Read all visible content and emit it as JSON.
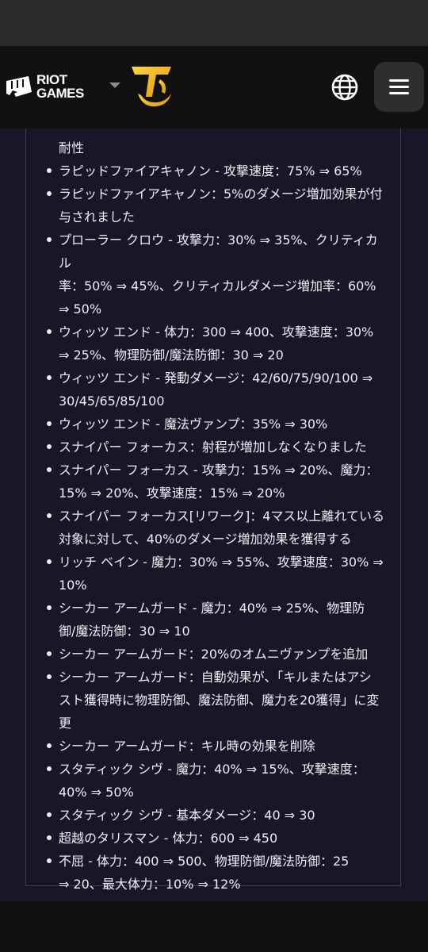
{
  "header": {
    "brand_line1": "RIOT",
    "brand_line2": "GAMES",
    "game_logo": "tft-logo",
    "language_icon": "globe-icon",
    "menu_icon": "hamburger-menu-icon"
  },
  "notes": {
    "cutoff_top": "…",
    "items": [
      {
        "lines": [
          "耐性"
        ],
        "continuation": true
      },
      {
        "lines": [
          "ラピッドファイアキャノン - 攻撃速度：75% ⇒ 65%"
        ]
      },
      {
        "lines": [
          "ラピッドファイアキャノン：5%のダメージ増加効果が付",
          "与されました"
        ]
      },
      {
        "lines": [
          "プローラー クロウ - 攻撃力：30% ⇒ 35%、クリティカル",
          "率：50% ⇒ 45%、クリティカルダメージ増加率：60%",
          "⇒ 50%"
        ]
      },
      {
        "lines": [
          "ウィッツ エンド - 体力：300 ⇒ 400、攻撃速度：30%",
          "⇒ 25%、物理防御/魔法防御：30 ⇒ 20"
        ]
      },
      {
        "lines": [
          "ウィッツ エンド - 発動ダメージ：42/60/75/90/100 ⇒",
          "30/45/65/85/100"
        ]
      },
      {
        "lines": [
          "ウィッツ エンド - 魔法ヴァンプ：35% ⇒ 30%"
        ]
      },
      {
        "lines": [
          "スナイパー フォーカス：射程が増加しなくなりました"
        ]
      },
      {
        "lines": [
          "スナイパー フォーカス - 攻撃力：15% ⇒ 20%、魔力：",
          "15% ⇒ 20%、攻撃速度：15% ⇒ 20%"
        ]
      },
      {
        "lines": [
          "スナイパー フォーカス[リワーク]：4マス以上離れている",
          "対象に対して、40%のダメージ増加効果を獲得する"
        ]
      },
      {
        "lines": [
          "リッチ ベイン - 魔力：30% ⇒ 55%、攻撃速度：30% ⇒",
          "10%"
        ]
      },
      {
        "lines": [
          "シーカー アームガード - 魔力：40% ⇒ 25%、物理防",
          "御/魔法防御：30 ⇒ 10"
        ]
      },
      {
        "lines": [
          "シーカー アームガード：20%のオムニヴァンプを追加"
        ]
      },
      {
        "lines": [
          "シーカー アームガード：自動効果が、「キルまたはアシ",
          "スト獲得時に物理防御、魔法防御、魔力を20獲得」に変",
          "更"
        ]
      },
      {
        "lines": [
          "シーカー アームガード：キル時の効果を削除"
        ]
      },
      {
        "lines": [
          "スタティック シヴ - 魔力：40% ⇒ 15%、攻撃速度：",
          "40% ⇒ 50%"
        ]
      },
      {
        "lines": [
          "スタティック シヴ - 基本ダメージ：40 ⇒ 30"
        ]
      },
      {
        "lines": [
          "超越のタリスマン - 体力：600 ⇒ 450"
        ]
      },
      {
        "lines": [
          "不屈 - 体力：400 ⇒ 500、物理防御/魔法防御：25",
          "⇒ 20、最大体力：10% ⇒ 12%"
        ]
      }
    ]
  }
}
